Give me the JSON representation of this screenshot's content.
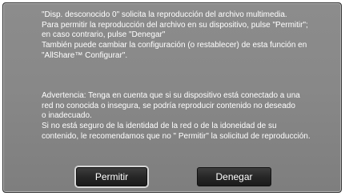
{
  "dialog": {
    "paragraph1": [
      "\"Disp. desconocido 0\" solicita la reproducción del archivo multimedia.",
      "Para permitir la reproducción del archivo en su dispositivo, pulse \"Permitir\";",
      "en caso contrario, pulse \"Denegar\"",
      "También puede cambiar la configuración (o restablecer) de esta función en",
      "\"AllShare™ Configurar\"."
    ],
    "paragraph2": [
      "Advertencia: Tenga en cuenta que si su dispositivo está conectado a una",
      "red no conocida o insegura, se podría reproducir contenido no deseado",
      "o inadecuado.",
      "Si no está seguro de la identidad de la red o de la idoneidad de su",
      "contenido, le recomendamos que no \" Permitir\" la solicitud de reproducción."
    ],
    "buttons": {
      "allow_label": "Permitir",
      "deny_label": "Denegar"
    }
  }
}
